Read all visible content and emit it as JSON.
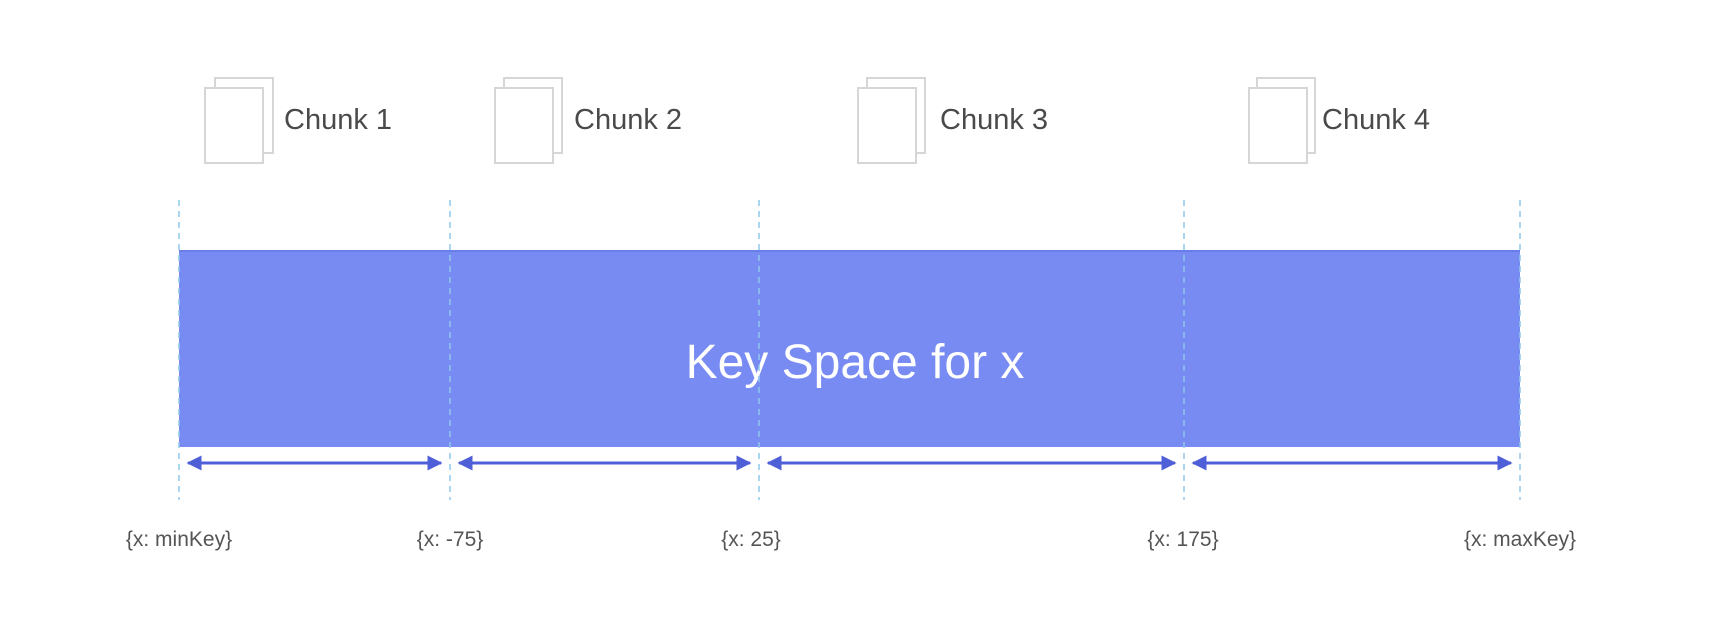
{
  "keyspace": {
    "label": "Key Space for x",
    "fill_color": "#788bf3",
    "edge_color": "#6a7ee8"
  },
  "boundaries": [
    {
      "label": "{x: minKey}"
    },
    {
      "label": "{x: -75}"
    },
    {
      "label": "{x: 25}"
    },
    {
      "label": "{x: 175}"
    },
    {
      "label": "{x: maxKey}"
    }
  ],
  "chunks": [
    {
      "label": "Chunk 1",
      "icon": "document-stack-icon"
    },
    {
      "label": "Chunk 2",
      "icon": "document-stack-icon"
    },
    {
      "label": "Chunk 3",
      "icon": "document-stack-icon"
    },
    {
      "label": "Chunk 4",
      "icon": "document-stack-icon"
    }
  ],
  "colors": {
    "divider": "#8fc8ec",
    "range_arrow": "#4f5fd8",
    "chunk_icon_stroke": "#d6d6d6",
    "chunk_text": "#4a4a4a",
    "boundary_text": "#555555"
  }
}
